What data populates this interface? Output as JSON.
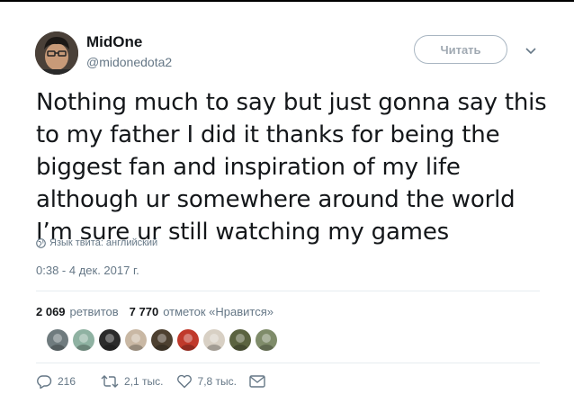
{
  "user": {
    "name": "MidOne",
    "handle": "@midonedota2",
    "follow_label": "Читать"
  },
  "tweet": {
    "text": "Nothing much to say but just gonna say this to my father I did it thanks for being the biggest fan and inspiration of my life although ur somewhere around the world I’m sure ur still watching my games",
    "language": "Язык твита: английский",
    "timestamp": "0:38 - 4 дек. 2017 г."
  },
  "stats": {
    "retweets_count": "2 069",
    "retweets_label": "ретвитов",
    "likes_count": "7 770",
    "likes_label": "отметок «Нравится»"
  },
  "likers": [
    {
      "name": "liker-1",
      "color": "#6f7b7e"
    },
    {
      "name": "liker-2",
      "color": "#8fb2a2"
    },
    {
      "name": "liker-3",
      "color": "#2b2b2b"
    },
    {
      "name": "liker-4",
      "color": "#c9b8a4"
    },
    {
      "name": "liker-5",
      "color": "#4d4030"
    },
    {
      "name": "liker-6",
      "color": "#c0392b"
    },
    {
      "name": "liker-7",
      "color": "#d8d0c4"
    },
    {
      "name": "liker-8",
      "color": "#5b6340"
    },
    {
      "name": "liker-9",
      "color": "#7f8c6a"
    }
  ],
  "actions": {
    "replies": "216",
    "retweets": "2,1 тыс.",
    "likes": "7,8 тыс."
  }
}
